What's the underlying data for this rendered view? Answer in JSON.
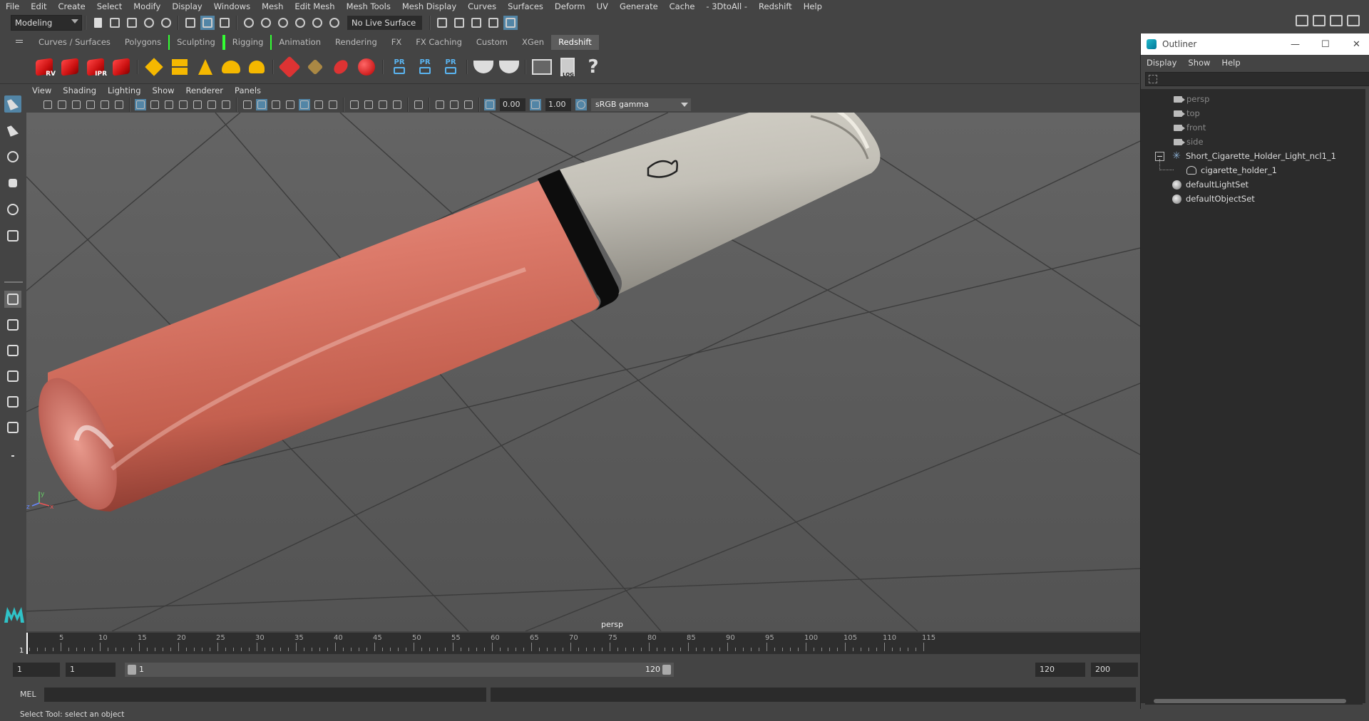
{
  "menubar": [
    "File",
    "Edit",
    "Create",
    "Select",
    "Modify",
    "Display",
    "Windows",
    "Mesh",
    "Edit Mesh",
    "Mesh Tools",
    "Mesh Display",
    "Curves",
    "Surfaces",
    "Deform",
    "UV",
    "Generate",
    "Cache",
    "- 3DtoAll -",
    "Redshift",
    "Help"
  ],
  "status": {
    "mode": "Modeling",
    "live_surface": "No Live Surface"
  },
  "shelf_tabs": [
    {
      "label": "Curves / Surfaces"
    },
    {
      "label": "Polygons"
    },
    {
      "label": "Sculpting"
    },
    {
      "label": "Rigging"
    },
    {
      "label": "Animation"
    },
    {
      "label": "Rendering"
    },
    {
      "label": "FX"
    },
    {
      "label": "FX Caching"
    },
    {
      "label": "Custom"
    },
    {
      "label": "XGen"
    },
    {
      "label": "Redshift"
    }
  ],
  "shelf": {
    "rv": "RV",
    "ipr": "IPR",
    "pr": "PR",
    "log": "LOG",
    "help": "?"
  },
  "viewport": {
    "menu": [
      "View",
      "Shading",
      "Lighting",
      "Show",
      "Renderer",
      "Panels"
    ],
    "exposure": "0.00",
    "gamma": "1.00",
    "color_space": "sRGB gamma",
    "camera_label": "persp",
    "axes": {
      "y": "y",
      "x": "x",
      "z": "z"
    }
  },
  "outliner": {
    "title": "Outliner",
    "window_buttons": {
      "minimize": "—",
      "maximize": "☐",
      "close": "✕"
    },
    "menu": [
      "Display",
      "Show",
      "Help"
    ],
    "items": [
      {
        "label": "persp"
      },
      {
        "label": "top"
      },
      {
        "label": "front"
      },
      {
        "label": "side"
      },
      {
        "label": "Short_Cigarette_Holder_Light_ncl1_1"
      },
      {
        "label": "cigarette_holder_1"
      },
      {
        "label": "defaultLightSet"
      },
      {
        "label": "defaultObjectSet"
      }
    ]
  },
  "timeline": {
    "ticks": [
      "5",
      "10",
      "15",
      "20",
      "25",
      "30",
      "35",
      "40",
      "45",
      "50",
      "55",
      "60",
      "65",
      "70",
      "75",
      "80",
      "85",
      "90",
      "95",
      "100",
      "105",
      "110",
      "115"
    ],
    "current_frame": "1"
  },
  "range": {
    "start": "1",
    "playback_start": "1",
    "slider_start": "1",
    "slider_end": "120",
    "playback_end": "120",
    "end": "200"
  },
  "mel": {
    "label": "MEL"
  },
  "help_line": "Select Tool: select an object",
  "colors": {
    "accent": "#5285a6",
    "holder_body": "#d9786a",
    "mouthpiece": "#c9c6bd"
  }
}
